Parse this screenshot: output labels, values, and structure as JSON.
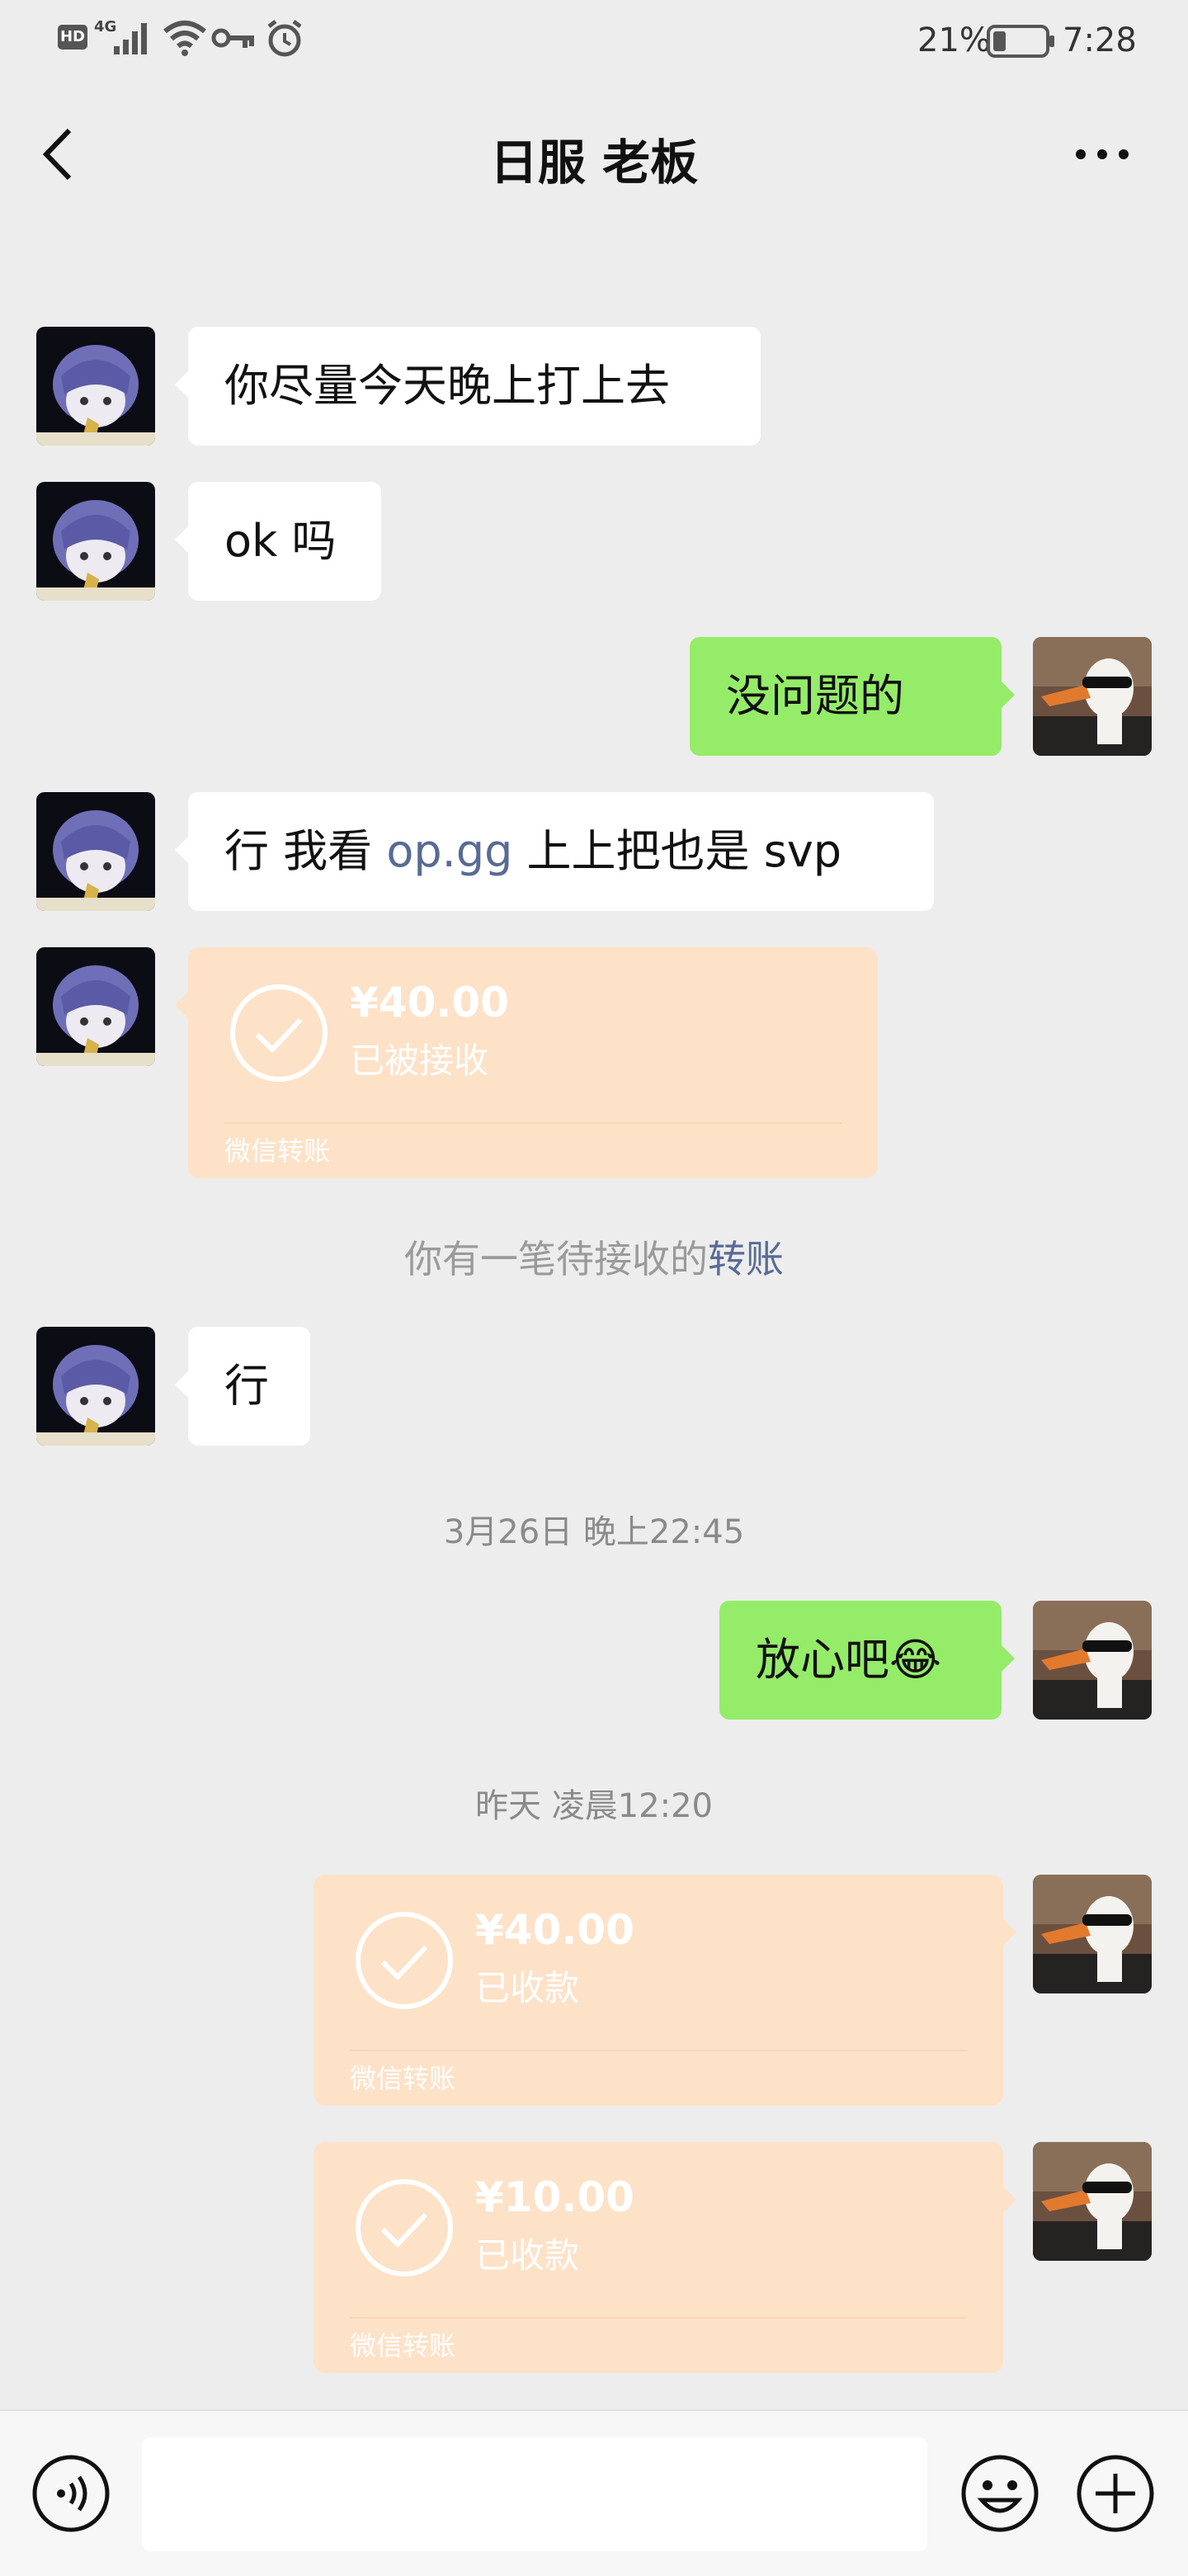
{
  "status_bar": {
    "left_icons": [
      "hd-icon",
      "4g-signal-icon",
      "wifi-icon",
      "key-icon",
      "alarm-icon"
    ],
    "hd": "HD",
    "network": "4G",
    "battery": "21%",
    "time": "7:28"
  },
  "header": {
    "back_icon": "chevron-left-icon",
    "title": "日服 老板",
    "more_icon": "more-dots-icon"
  },
  "messages": {
    "m1": "你尽量今天晚上打上去",
    "m2": "ok 吗",
    "m3": "没问题的",
    "m4_prefix": "行 我看 ",
    "m4_link": "op.gg",
    "m4_suffix": " 上上把也是 svp",
    "transfer1": {
      "amount": "¥40.00",
      "status": "已被接收",
      "footer": "微信转账"
    },
    "sys_prefix": "你有一笔待接收的",
    "sys_link": "转账",
    "m5": "行",
    "time1": "3月26日 晚上22:45",
    "m6": "放心吧",
    "m6_emoji": "😂",
    "time2": "昨天 凌晨12:20",
    "transfer2": {
      "amount": "¥40.00",
      "status": "已收款",
      "footer": "微信转账"
    },
    "transfer3": {
      "amount": "¥10.00",
      "status": "已收款",
      "footer": "微信转账"
    }
  },
  "bottom_bar": {
    "voice_icon": "voice-icon",
    "input_value": "",
    "emoji_icon": "emoji-icon",
    "plus_icon": "plus-icon"
  },
  "colors": {
    "background": "#ededed",
    "self_bubble": "#95ec69",
    "other_bubble": "#ffffff",
    "transfer_card": "#fde2c8",
    "link": "#576b95"
  }
}
